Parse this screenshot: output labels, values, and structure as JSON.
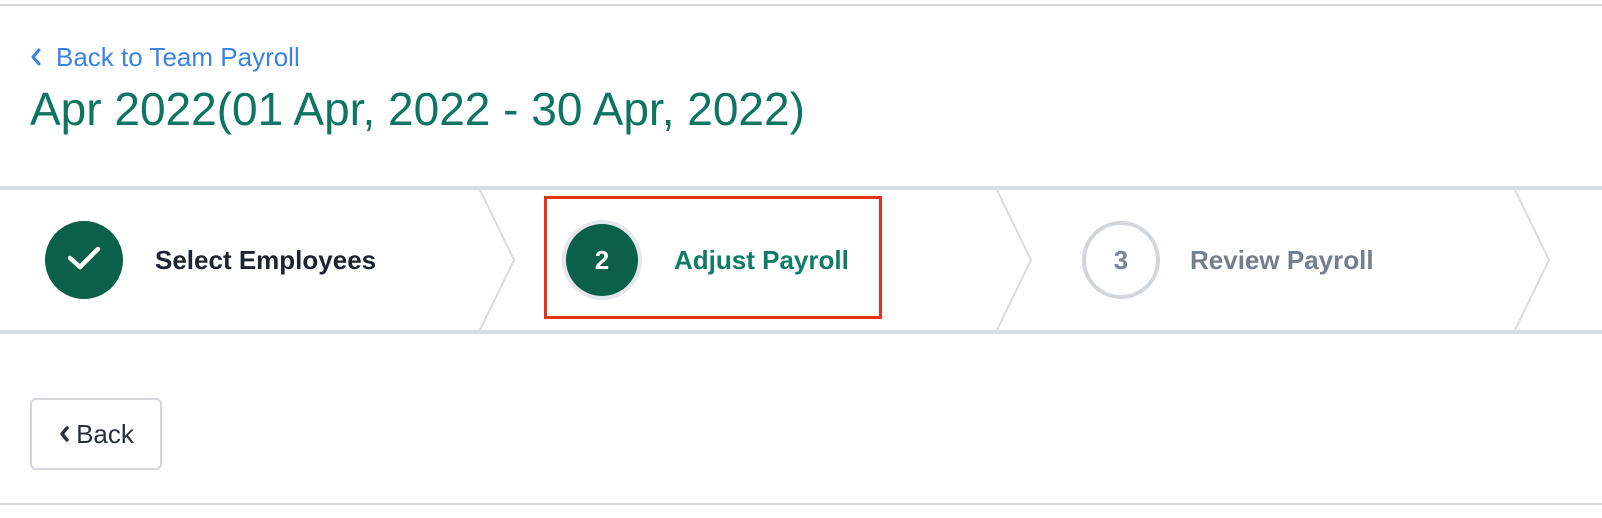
{
  "header": {
    "back_link_label": "Back to Team Payroll",
    "title": "Apr 2022(01 Apr, 2022 - 30 Apr, 2022)"
  },
  "stepper": {
    "steps": [
      {
        "number": "1",
        "label": "Select Employees",
        "status": "completed"
      },
      {
        "number": "2",
        "label": "Adjust Payroll",
        "status": "active"
      },
      {
        "number": "3",
        "label": "Review Payroll",
        "status": "upcoming"
      }
    ]
  },
  "actions": {
    "back_button_label": "Back"
  },
  "colors": {
    "title_green": "#0e7560",
    "step_fill_green": "#0a6048",
    "link_blue": "#3b82e6",
    "highlight_red": "#e3321f",
    "border_gray": "#d8dbe0"
  },
  "icons": {
    "back_link": "chevron-left-icon",
    "step_completed": "check-icon",
    "back_button": "chevron-left-icon"
  }
}
